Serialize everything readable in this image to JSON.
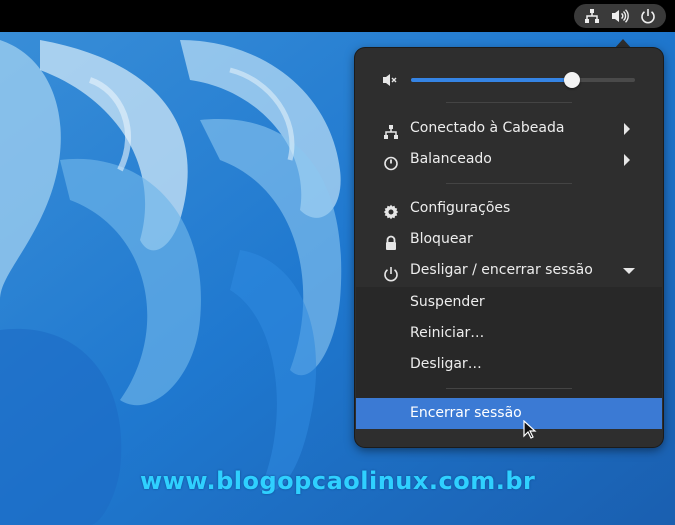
{
  "panel": {
    "status_icons": [
      "network-wired-icon",
      "volume-icon",
      "power-icon"
    ]
  },
  "menu": {
    "volume": {
      "level": 0.72,
      "icon": "speaker-muted-icon"
    },
    "items": [
      {
        "label": "Conectado à Cabeada",
        "icon": "network-wired-icon",
        "submenu": true
      },
      {
        "label": "Balanceado",
        "icon": "power-profile-icon",
        "submenu": true
      },
      {
        "label": "Configurações",
        "icon": "gear-icon"
      },
      {
        "label": "Bloquear",
        "icon": "lock-icon"
      },
      {
        "label": "Desligar / encerrar sessão",
        "icon": "power-icon",
        "expanded": true
      }
    ],
    "power_submenu": [
      {
        "label": "Suspender"
      },
      {
        "label": "Reiniciar…"
      },
      {
        "label": "Desligar…"
      },
      {
        "label": "Encerrar sessão",
        "highlighted": true
      }
    ]
  },
  "colors": {
    "accent": "#3584e4",
    "highlight": "#3b7ad4",
    "menu_bg": "#2e2e2e",
    "watermark": "#2fd0ff"
  },
  "watermark": "www.blogopcaolinux.com.br"
}
